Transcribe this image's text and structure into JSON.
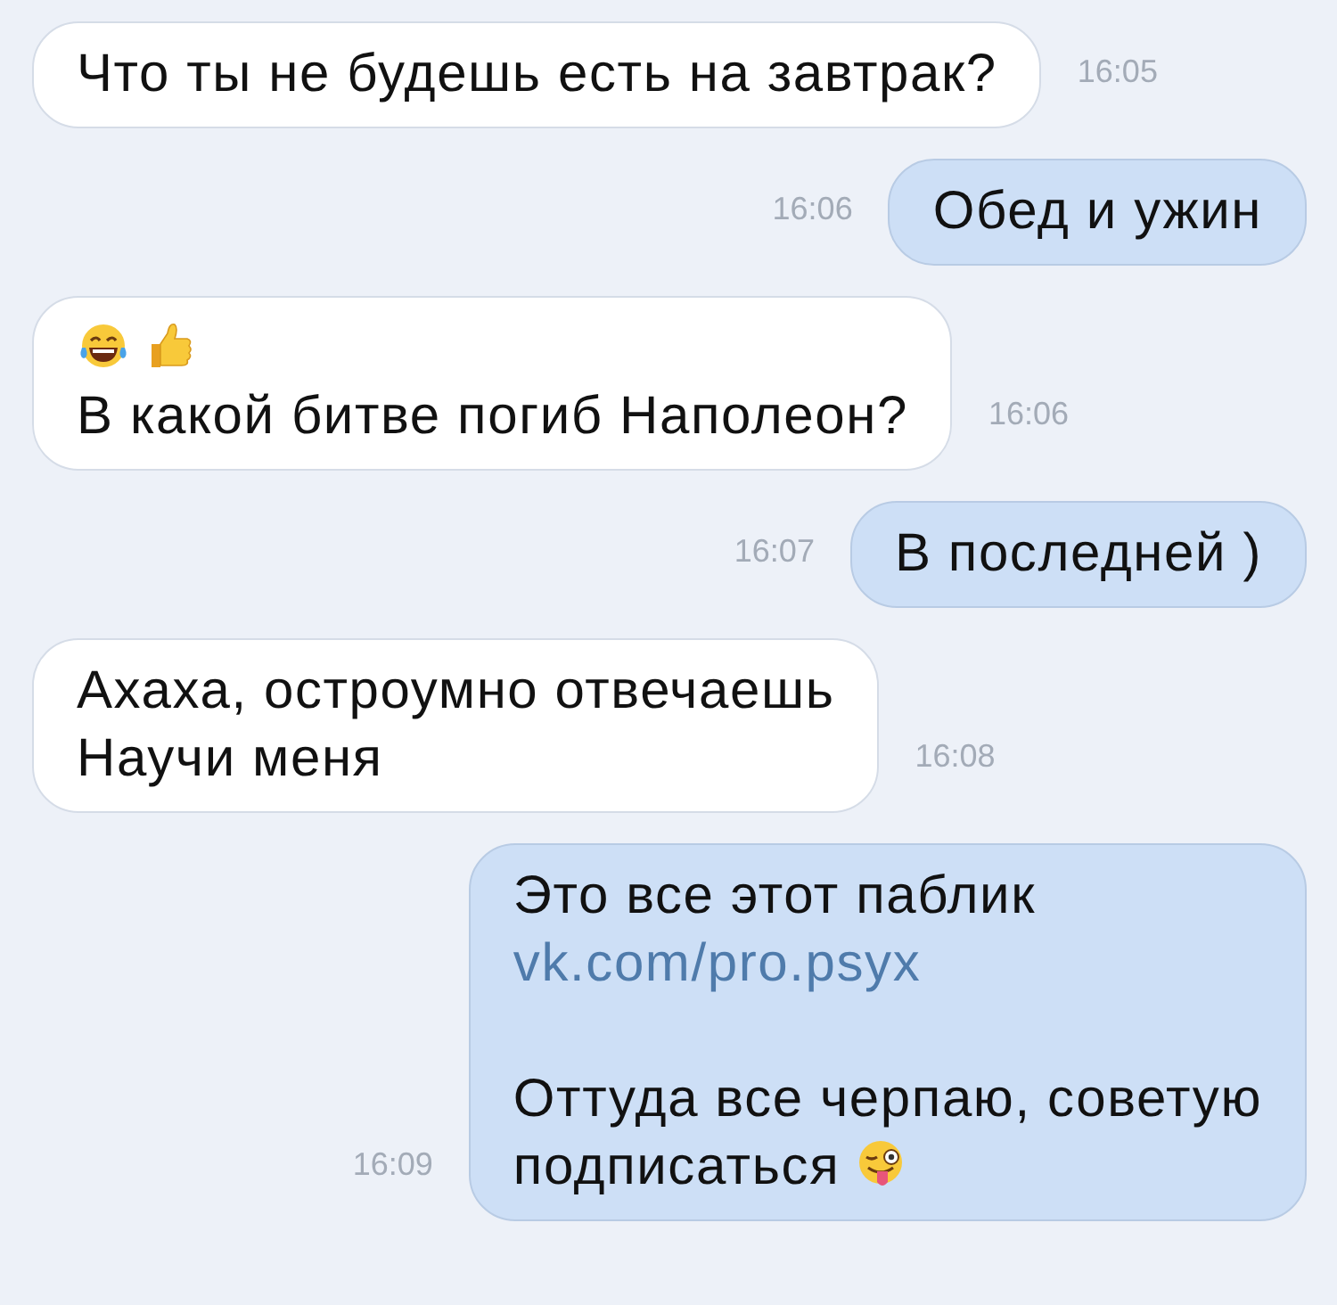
{
  "messages": [
    {
      "kind": "incoming",
      "time": "16:05",
      "parts": [
        {
          "kind": "text",
          "text": "Что ты не будешь есть на завтрак?"
        }
      ]
    },
    {
      "kind": "outgoing",
      "time": "16:06",
      "parts": [
        {
          "kind": "text",
          "text": "Обед и ужин"
        }
      ]
    },
    {
      "kind": "incoming",
      "time": "16:06",
      "parts": [
        {
          "kind": "laughing"
        },
        {
          "kind": "thumbsup"
        },
        {
          "kind": "break"
        },
        {
          "kind": "text",
          "text": "В какой битве погиб Наполеон?"
        }
      ]
    },
    {
      "kind": "outgoing",
      "time": "16:07",
      "parts": [
        {
          "kind": "text",
          "text": "В последней )"
        }
      ]
    },
    {
      "kind": "incoming",
      "time": "16:08",
      "parts": [
        {
          "kind": "text",
          "text": "Ахаха, остроумно отвечаешь"
        },
        {
          "kind": "break"
        },
        {
          "kind": "text",
          "text": "Научи меня"
        }
      ]
    },
    {
      "kind": "outgoing",
      "time": "16:09",
      "parts": [
        {
          "kind": "text",
          "text": "Это все этот паблик"
        },
        {
          "kind": "break"
        },
        {
          "kind": "link",
          "text": "vk.com/pro.psyx"
        },
        {
          "kind": "break"
        },
        {
          "kind": "break"
        },
        {
          "kind": "text",
          "text": "Оттуда все черпаю, советую"
        },
        {
          "kind": "break"
        },
        {
          "kind": "text",
          "text": "подписаться"
        },
        {
          "kind": "winking"
        }
      ]
    }
  ]
}
